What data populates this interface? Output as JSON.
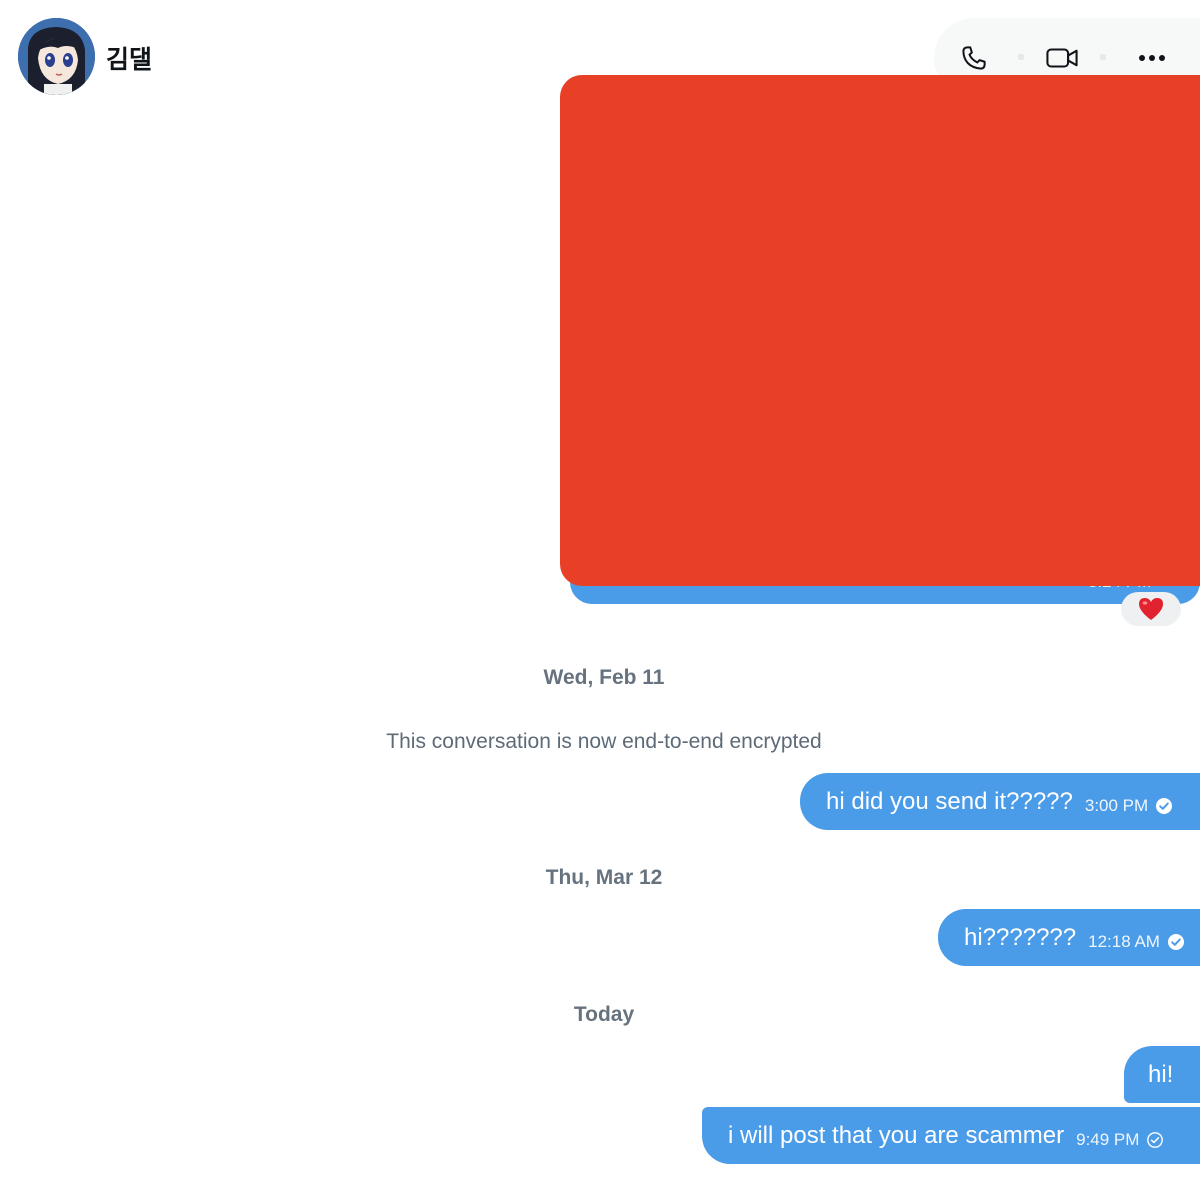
{
  "header": {
    "contact_name": "김댈",
    "avatar_icon": "anime-avatar-icon"
  },
  "actions": {
    "phone_icon": "phone-icon",
    "video_icon": "video-camera-icon",
    "more_icon": "more-horizontal-icon"
  },
  "colors": {
    "bubble": "#4a9be8",
    "redaction": "#e84027",
    "separator_text": "#66737f"
  },
  "image_message": {
    "time": "3:24 PM",
    "reaction": "❤️"
  },
  "separators": {
    "date_1": "Wed, Feb 11",
    "encryption_note": "This conversation is now end-to-end encrypted",
    "date_2": "Thu, Mar 12",
    "date_3": "Today"
  },
  "messages": [
    {
      "text": "hi did you send it?????",
      "time": "3:00 PM",
      "status": "read"
    },
    {
      "text": "hi???????",
      "time": "12:18 AM",
      "status": "read"
    },
    {
      "text": "hi!",
      "time": "",
      "status": ""
    },
    {
      "text": "i will post that you are scammer",
      "time": "9:49 PM",
      "status": "sent"
    }
  ]
}
